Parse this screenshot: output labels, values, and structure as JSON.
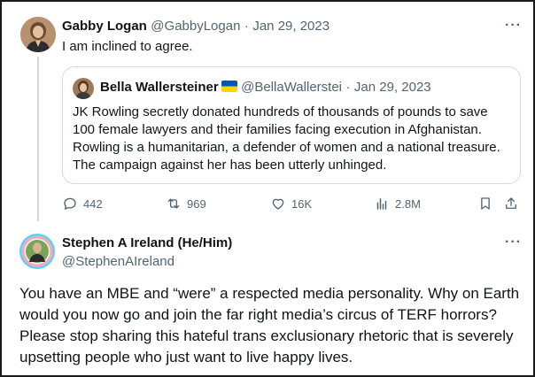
{
  "main_tweet": {
    "author_name": "Gabby Logan",
    "handle": "@GabbyLogan",
    "separator": "·",
    "date": "Jan 29, 2023",
    "text": "I am inclined to agree.",
    "more_label": "···"
  },
  "quoted_tweet": {
    "author_name": "Bella Wallersteiner",
    "flag_icon": "ukraine-flag-icon",
    "handle": "@BellaWallerstei",
    "separator": "·",
    "date": "Jan 29, 2023",
    "text": "JK Rowling secretly donated hundreds of thousands of pounds to save 100 female lawyers and their families facing execution in Afghanistan. Rowling is a humanitarian, a defender of women and a national treasure. The campaign against her has been utterly unhinged."
  },
  "actions": {
    "replies": "442",
    "retweets": "969",
    "likes": "16K",
    "views": "2.8M"
  },
  "reply_tweet": {
    "author_name": "Stephen A Ireland (He/Him)",
    "handle": "@StephenAIreland",
    "more_label": "···",
    "text": "You have an MBE and “were” a respected media personality. Why on Earth would you now go and join the far right media’s circus of TERF horrors?  Please stop sharing this hateful trans exclusionary rhetoric that is severely upsetting people who just want to live happy lives."
  },
  "colors": {
    "text": "#0f1419",
    "muted": "#536471",
    "border": "#cfd9de",
    "flag_blue": "#0057b7",
    "flag_yellow": "#ffd700"
  }
}
